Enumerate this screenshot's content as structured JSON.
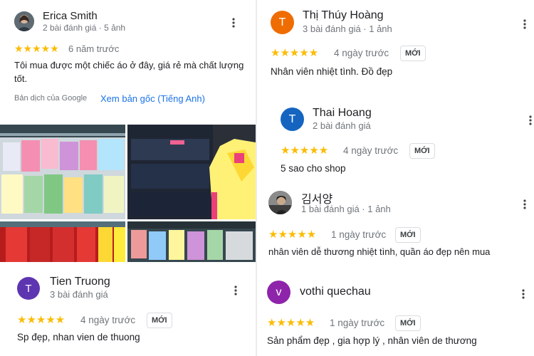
{
  "reviews": {
    "erica": {
      "name": "Erica Smith",
      "meta": "2 bài đánh giá · 5 ảnh",
      "stars": "★★★★★",
      "date": "6 năm trước",
      "text": "Tôi mua được một chiếc áo ở đây, giá rẻ mà chất lượng tốt.",
      "translation_label": "Bản dịch của Google",
      "original_link": "Xem bản gốc (Tiếng Anh)"
    },
    "tien": {
      "initial": "T",
      "name": "Tien Truong",
      "meta": "3 bài đánh giá",
      "stars": "★★★★★",
      "date": "4 ngày trước",
      "badge": "MỚI",
      "text": "Sp đẹp, nhan vien de thuong",
      "color": "#5e35b1"
    },
    "thuy": {
      "initial": "T",
      "name": "Thị Thúy Hoàng",
      "meta": "3 bài đánh giá · 1 ảnh",
      "stars": "★★★★★",
      "date": "4 ngày trước",
      "badge": "MỚI",
      "text": "Nhân viên nhiệt tình. Đồ đẹp",
      "color": "#ef6c00"
    },
    "thai": {
      "initial": "T",
      "name": "Thai Hoang",
      "meta": "2 bài đánh giá",
      "stars": "★★★★★",
      "date": "4 ngày trước",
      "badge": "MỚI",
      "text": "5 sao cho shop",
      "color": "#1565c0"
    },
    "kim": {
      "name": "김서양",
      "meta": "1 bài đánh giá · 1 ảnh",
      "stars": "★★★★★",
      "date": "1 ngày trước",
      "badge": "MỚI",
      "text": "nhân viên dễ thương nhiệt tình, quần áo đẹp nên mua"
    },
    "vothi": {
      "initial": "v",
      "name": "vothi quechau",
      "stars": "★★★★★",
      "date": "1 ngày trước",
      "badge": "MỚI",
      "text": "Sản phẩm đẹp , gia hợp lý , nhân viên de thương",
      "color": "#8e24aa"
    }
  },
  "colors": {
    "star": "#fbbc04",
    "link": "#1a73e8",
    "secondary_text": "#70757a"
  },
  "icons": {
    "more": "more-vert-icon"
  }
}
